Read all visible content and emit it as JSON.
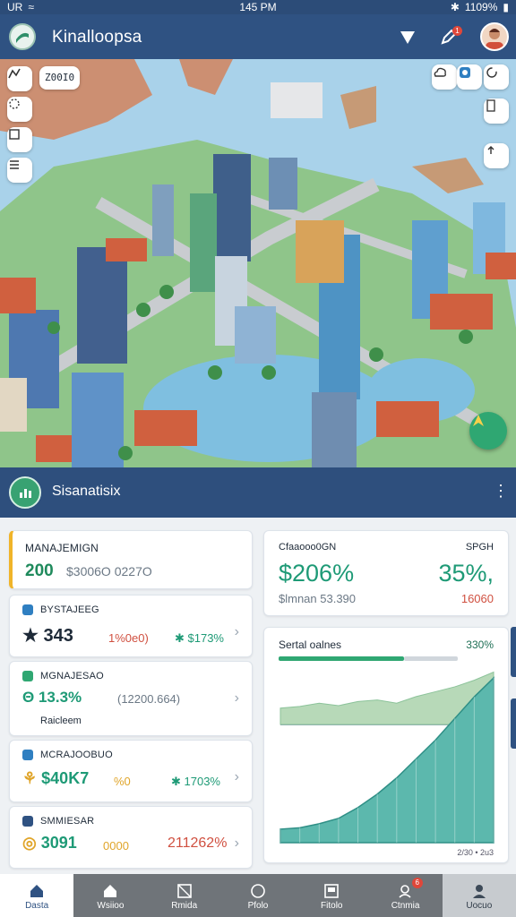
{
  "status_bar": {
    "left": "UR",
    "time": "145 PM",
    "battery": "1109%"
  },
  "header": {
    "title": "Kinalloopsa"
  },
  "map": {
    "chip_label": "Z00I0"
  },
  "stats_bar": {
    "title": "Sisanatisix",
    "menu": "⋮"
  },
  "cards": {
    "management": {
      "title": "MANAJEMIGN",
      "value": "200",
      "sub": "$3006O 0227O"
    },
    "summary": {
      "label_left": "Cfaaooo0GN",
      "label_right": "SPGH",
      "value_left": "$206%",
      "value_right": "35%,",
      "sub_left": "$lmnan 53.390",
      "sub_right": "16060"
    },
    "list": [
      {
        "title": "BYSTAJEEG",
        "value": "343",
        "delta_bad": "1%0e0)",
        "delta_good": "$173%",
        "icon_left": "★"
      },
      {
        "title": "MGNAJESAO",
        "value": "13.3%",
        "delta_bad": "(12200.664)",
        "extra": "Raicleem",
        "icon_left": "Θ"
      },
      {
        "title": "MCRAJOOBUO",
        "value": "$40K7",
        "delta_bad": "%0",
        "delta_good": "1703%",
        "icon_left": "⚘"
      },
      {
        "title": "SMMIESAR",
        "value": "3091",
        "delta_bad": "0000",
        "delta_good": "211262%",
        "icon_left": "◎"
      }
    ]
  },
  "chart_data": {
    "type": "area",
    "title": "Sertal oalnes",
    "value_label": "330%",
    "x_label": "2/30 • 2u3",
    "series": [
      {
        "values": [
          10,
          11,
          14,
          18,
          26,
          36,
          48,
          62,
          76,
          92,
          108,
          122
        ]
      }
    ],
    "top_series": [
      {
        "values": [
          60,
          62,
          66,
          63,
          68,
          70,
          66,
          74,
          80,
          86,
          94,
          104
        ]
      }
    ],
    "ylim": [
      0,
      130
    ]
  },
  "bottom_nav": {
    "items": [
      {
        "label": "Dasta"
      },
      {
        "label": "Wsiioo"
      },
      {
        "label": "Rmida"
      },
      {
        "label": "Pfolo"
      },
      {
        "label": "Fitolo"
      },
      {
        "label": "Ctnmia",
        "badge": "6"
      },
      {
        "label": "Uocuo"
      }
    ]
  },
  "colors": {
    "header": "#2f5282",
    "accent": "#1e9a76",
    "bad": "#d05040"
  }
}
